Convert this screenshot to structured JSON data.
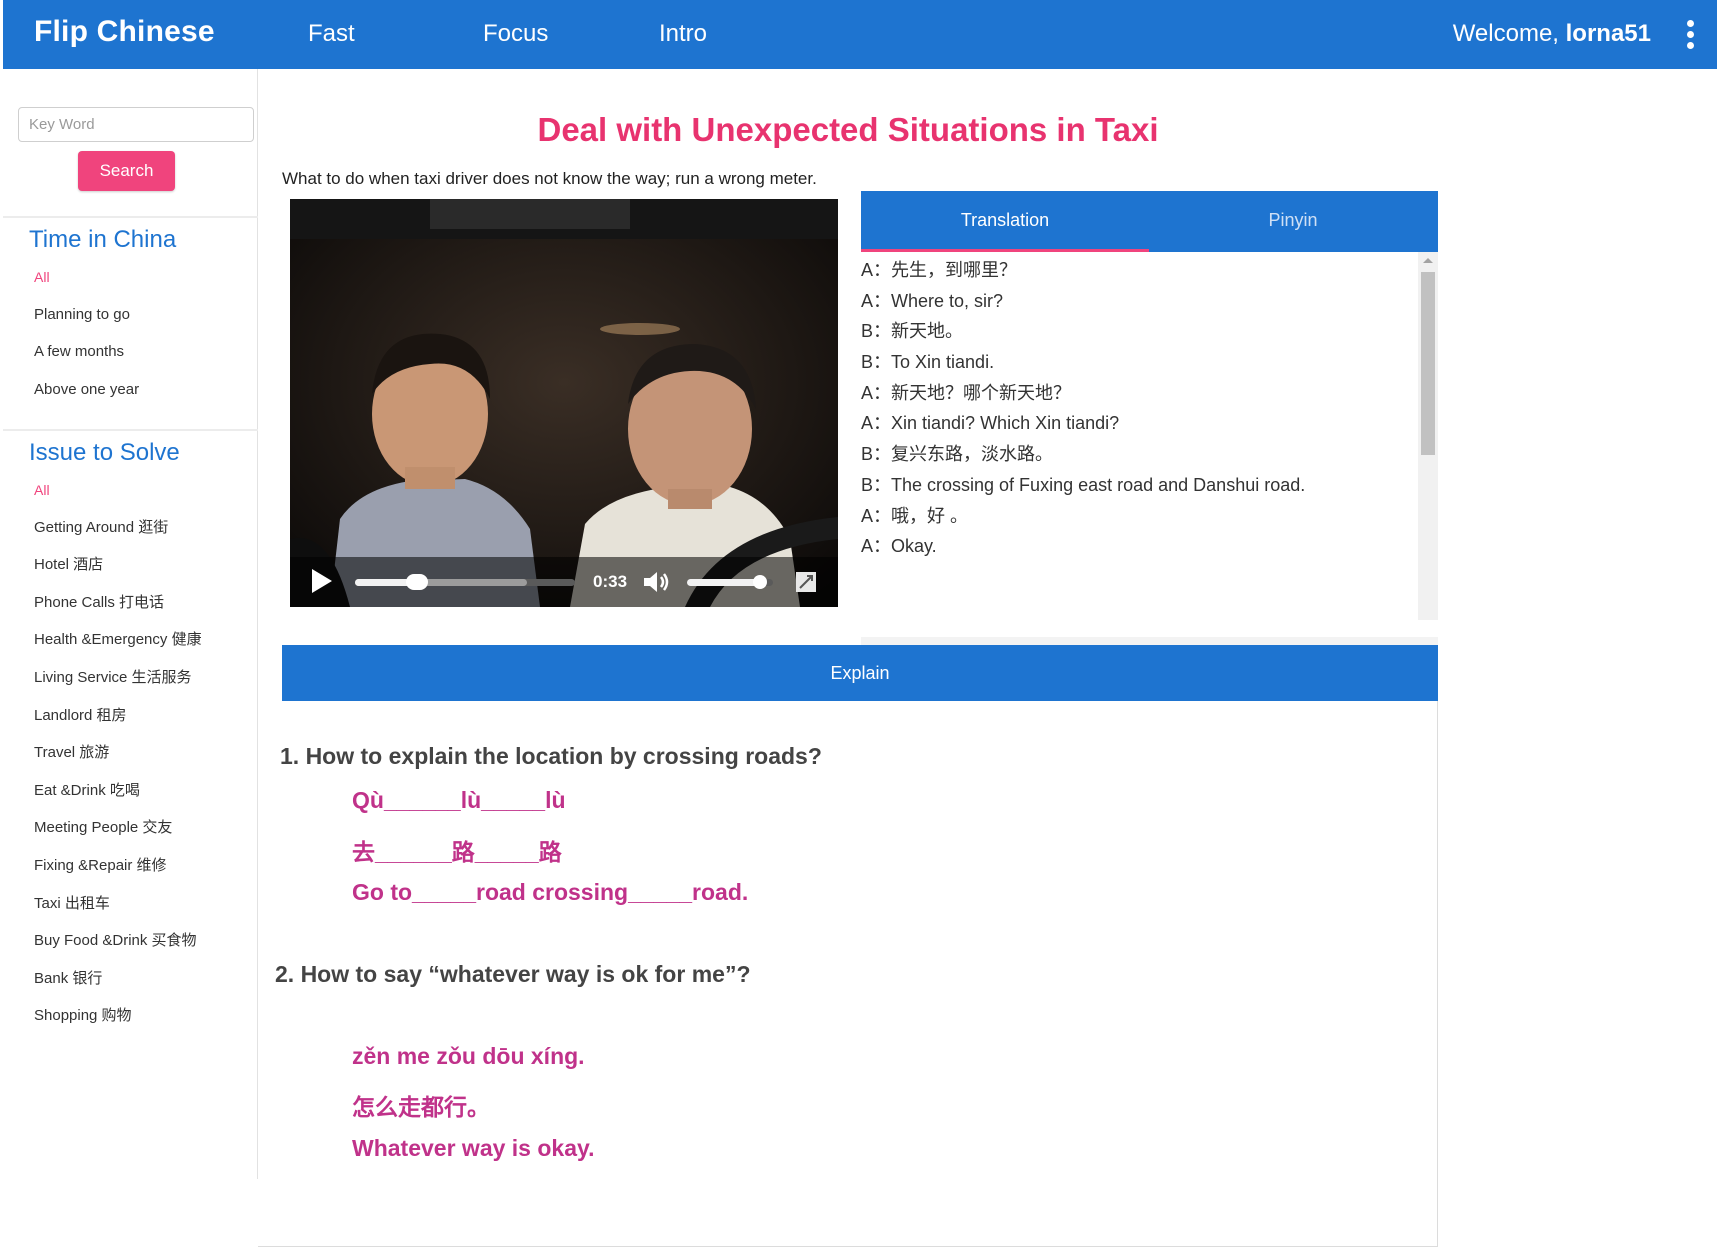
{
  "header": {
    "brand": "Flip Chinese",
    "nav": [
      "Fast",
      "Focus",
      "Intro"
    ],
    "welcome_prefix": "Welcome, ",
    "username": "lorna51"
  },
  "sidebar": {
    "search": {
      "placeholder": "Key Word",
      "button": "Search"
    },
    "sections": [
      {
        "title": "Time in China",
        "items": [
          "All",
          "Planning to go",
          "A few months",
          "Above one year"
        ]
      },
      {
        "title": "Issue to Solve",
        "items": [
          "All",
          "Getting Around 逛街",
          "Hotel 酒店",
          "Phone Calls 打电话",
          "Health &Emergency 健康",
          "Living Service 生活服务",
          "Landlord 租房",
          "Travel 旅游",
          "Eat &Drink 吃喝",
          "Meeting People 交友",
          "Fixing &Repair 维修",
          "Taxi 出租车",
          "Buy Food &Drink 买食物",
          "Bank 银行",
          "Shopping 购物"
        ]
      }
    ]
  },
  "lesson": {
    "title": "Deal with Unexpected Situations in Taxi",
    "subtitle": "What to do when taxi driver does not know the way; run a wrong meter."
  },
  "video": {
    "time": "0:33",
    "progress_fraction": 0.28,
    "buffered_fraction": 0.78,
    "volume_fraction": 0.85
  },
  "transcript": {
    "tabs": [
      "Translation",
      "Pinyin"
    ],
    "active_tab": "Translation",
    "lines": [
      "A：先生，到哪里？",
      "A：Where to, sir?",
      "B：新天地。",
      "B：To Xin tiandi.",
      "A：新天地？哪个新天地？",
      "A：Xin tiandi? Which Xin tiandi?",
      "B：复兴东路，淡水路。",
      "B：The crossing of Fuxing east road and Danshui road.",
      "A：哦，好 。",
      "A：Okay."
    ]
  },
  "explain": {
    "bar_label": "Explain",
    "questions": [
      {
        "question": "1. How to explain the location by crossing roads?",
        "answers": [
          "Qù______lù_____lù",
          "去______路_____路",
          "Go to_____road  crossing_____road."
        ]
      },
      {
        "question": "2. How to say “whatever way is ok for me”?",
        "answers": [
          "zěn me zǒu dōu xíng.",
          "怎么走都行。",
          "Whatever way is okay."
        ]
      }
    ]
  },
  "colors": {
    "primary": "#1e74d0",
    "accent": "#f0447d",
    "title": "#e8336f",
    "answer": "#c0328a"
  },
  "icons": {
    "menu": "more-vert-icon",
    "play": "play-icon",
    "volume": "volume-icon",
    "fullscreen": "fullscreen-icon"
  }
}
